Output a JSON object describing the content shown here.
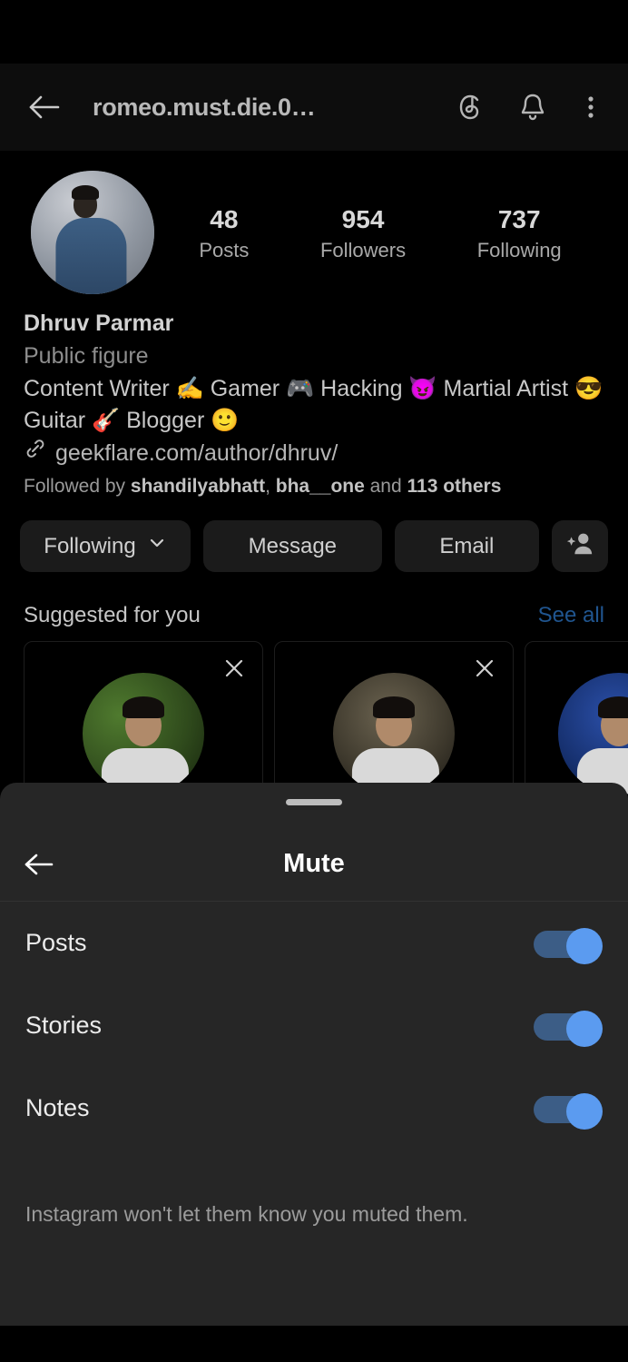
{
  "header": {
    "title": "romeo.must.die.0…",
    "back_icon": "back-arrow-icon",
    "threads_icon": "threads-icon",
    "bell_icon": "bell-icon",
    "menu_icon": "three-dots-icon"
  },
  "profile": {
    "avatar_alt": "profile-avatar",
    "stats": [
      {
        "num": "48",
        "label": "Posts"
      },
      {
        "num": "954",
        "label": "Followers"
      },
      {
        "num": "737",
        "label": "Following"
      }
    ],
    "name": "Dhruv Parmar",
    "category": "Public figure",
    "bio_line1": "Content Writer ✍️ Gamer 🎮 Hacking 😈 Martial Artist 😎",
    "bio_line2": "Guitar 🎸 Blogger 🙂",
    "link": "geekflare.com/author/dhruv/",
    "link_icon": "link-icon",
    "followed_by_prefix": "Followed by ",
    "followed_by_user1": "shandilyabhatt",
    "followed_by_sep": ", ",
    "followed_by_user2": "bha__one",
    "followed_by_mid": " and ",
    "followed_by_others": "113 others"
  },
  "actions": {
    "following_label": "Following",
    "following_chevron": "chevron-down-icon",
    "message_label": "Message",
    "email_label": "Email",
    "add_person_icon": "add-person-icon"
  },
  "suggested": {
    "title": "Suggested for you",
    "see_all": "See all",
    "cards": [
      {
        "name": "suggested-user-1",
        "close_icon": "close-icon"
      },
      {
        "name": "suggested-user-2",
        "close_icon": "close-icon"
      },
      {
        "name": "suggested-user-3",
        "close_icon": "close-icon"
      }
    ]
  },
  "sheet": {
    "handle": "drag-handle",
    "back_icon": "back-arrow-icon",
    "title": "Mute",
    "rows": [
      {
        "label": "Posts",
        "on": true
      },
      {
        "label": "Stories",
        "on": true
      },
      {
        "label": "Notes",
        "on": true
      }
    ],
    "note": "Instagram won't let them know you muted them."
  },
  "colors": {
    "background": "#000000",
    "sheet_bg": "#262626",
    "button_bg": "#1b1b1b",
    "accent_blue": "#20558f",
    "toggle_thumb": "#5b9bf0",
    "toggle_track": "#3c5d86"
  }
}
